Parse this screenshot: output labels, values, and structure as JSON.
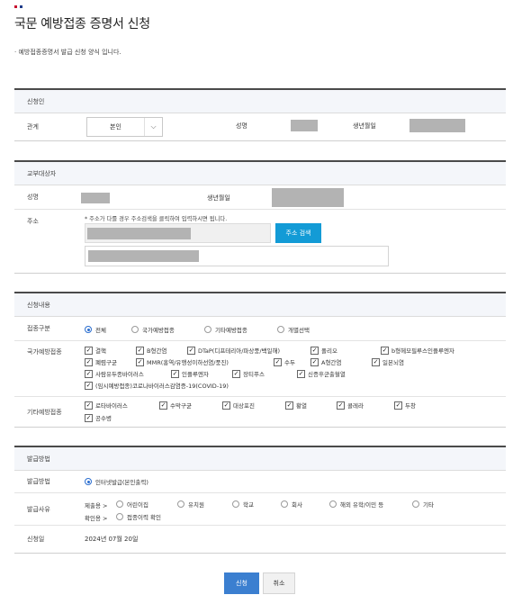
{
  "page": {
    "title": "국문 예방접종 증명서 신청",
    "intro": "· 예방접종증명서 발급 신청 양식 입니다."
  },
  "applicant": {
    "section_title": "신청인",
    "relation_label": "관계",
    "relation_value": "본인",
    "name_label": "성명",
    "birth_label": "생년월일"
  },
  "recipient": {
    "section_title": "교부대상자",
    "name_label": "성명",
    "birth_label": "생년월일",
    "address_label": "주소",
    "address_note": "* 주소가 다를 경우 주소검색을 클릭하여 입력하시면 됩니다.",
    "address_search_button": "주소 검색"
  },
  "contents": {
    "section_title": "신청내용",
    "type_label": "접종구분",
    "type_options": [
      "전체",
      "국가예방접종",
      "기타예방접종",
      "개별선택"
    ],
    "type_selected": "전체",
    "national_label": "국가예방접종",
    "national_items": [
      "결핵",
      "B형간염",
      "DTaP(디프테리아/파상풍/백일해)",
      "폴리오",
      "b형헤모필루스인플루엔자",
      "폐렴구균",
      "MMR(홍역/유행성이하선염/풍진)",
      "수두",
      "A형간염",
      "일본뇌염",
      "사람유두종바이러스",
      "인플루엔자",
      "장티푸스",
      "신증후군출혈열",
      "(임시예방접종)코로나바이러스감염증-19(COVID-19)"
    ],
    "other_label": "기타예방접종",
    "other_items": [
      "로타바이러스",
      "수막구균",
      "대상포진",
      "황열",
      "콜레라",
      "두창",
      "공수병"
    ]
  },
  "issuance": {
    "section_title": "발급방법",
    "method_label": "발급방법",
    "method_value": "인터넷발급(본인출력)",
    "reason_label": "발급사유",
    "reason_submit_prefix": "제출용 >",
    "reason_submit_options": [
      "어린이집",
      "유치원",
      "학교",
      "회사",
      "해외 유학/이민 등",
      "기타"
    ],
    "reason_confirm_prefix": "확인용 >",
    "reason_confirm_options": [
      "접종이력 확인"
    ],
    "date_label": "신청일",
    "date_value": "2024년 07월 20일"
  },
  "actions": {
    "submit": "신청",
    "cancel": "취소"
  },
  "colors": {
    "primary": "#3b7fd0",
    "address_button": "#139bd6",
    "section_header_bg": "#f4f6fa",
    "masked": "#b3b3b3"
  }
}
